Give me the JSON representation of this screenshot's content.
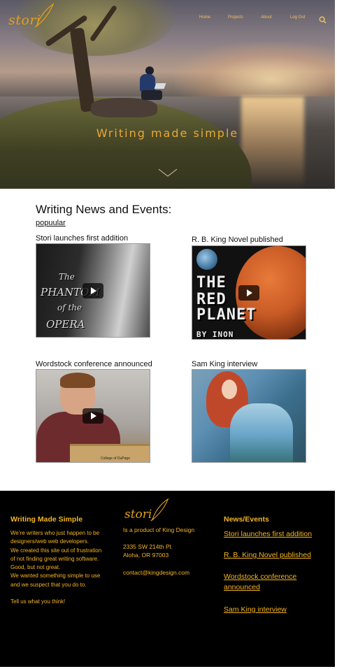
{
  "header": {
    "logo_text": "stori",
    "nav": [
      "Home",
      "Projects",
      "About",
      "Log Out"
    ],
    "icons": [
      "quill-icon",
      "search-icon",
      "chevron-down-icon"
    ],
    "hero_title": "Writing made simple"
  },
  "news": {
    "title": "Writing News and Events:",
    "filter_link": "popuular",
    "cards": [
      {
        "title": "Stori launches first addition",
        "image_text": [
          "The",
          "PHANTOM",
          "of the",
          "OPERA"
        ]
      },
      {
        "title": "R. B. King Novel published",
        "image_text": [
          "THE",
          "RED",
          "PLANET",
          "BY INON"
        ]
      },
      {
        "title": "Wordstock conference announced",
        "image_text": [
          "College of DuPage"
        ]
      },
      {
        "title": "Sam King interview"
      }
    ]
  },
  "footer": {
    "col1": {
      "title": "Writing Made Simple",
      "lines": [
        "We’re writers who just happen to be designers/web web developers.",
        "We created this site out of frustration of not finding great writing software. Good, but not great.",
        "We wanted something simple to use and we suspect that you do to.",
        "Tell us what you think!"
      ]
    },
    "col2": {
      "logo_text": "stori",
      "product": "Is a product of King Design",
      "address_line1": "2335 SW 214th Pl.",
      "address_line2": "Aloha, OR 97003",
      "email": "contact@kingdesign.com"
    },
    "col3": {
      "title": "News/Events",
      "links": [
        "Stori launches first addition",
        "R. B. King Novel published",
        "Wordstock conference announced",
        "Sam King interview"
      ]
    }
  },
  "colors": {
    "accent": "#f5b520",
    "hero_title": "#e8a73a",
    "footer_bg": "#000000"
  }
}
